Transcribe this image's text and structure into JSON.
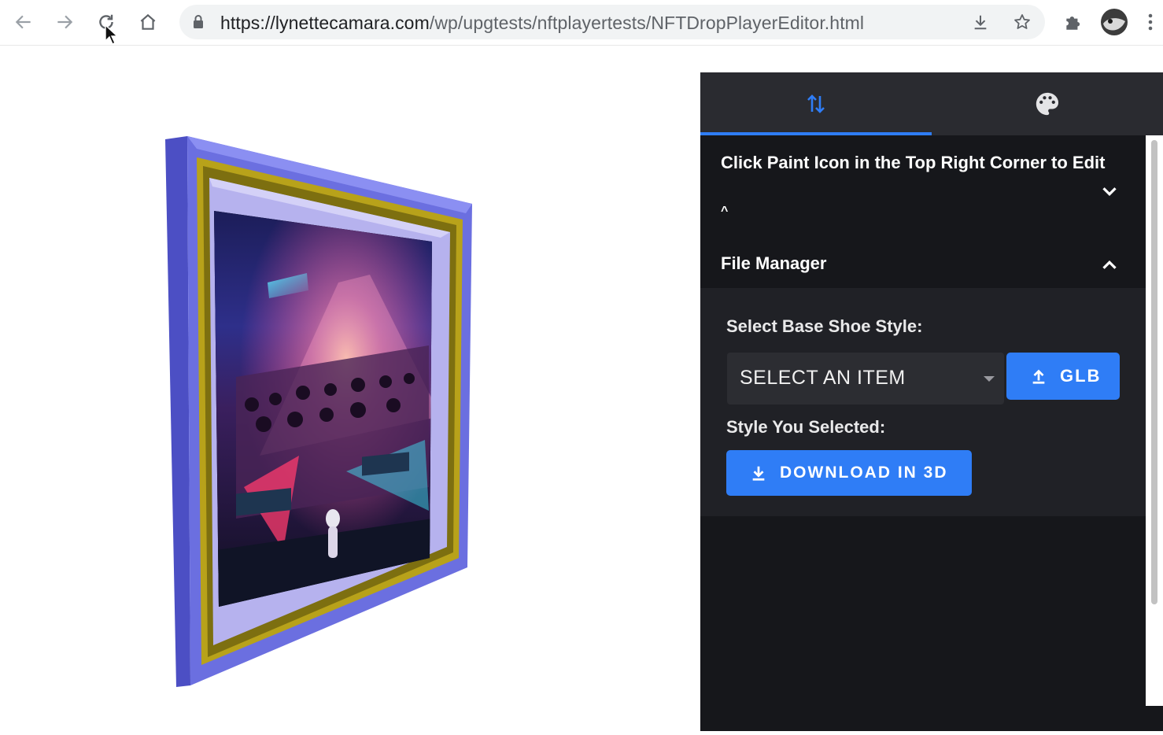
{
  "browser": {
    "url_host": "https://lynettecamara.com",
    "url_path": "/wp/upgtests/nftplayertests/NFTDropPlayerEditor.html"
  },
  "panel": {
    "tabs": [
      {
        "icon": "sort-arrows-icon",
        "active": true
      },
      {
        "icon": "palette-icon",
        "active": false
      }
    ],
    "instructions": {
      "title": "Click Paint Icon in the Top Right Corner to Edit",
      "caret_text": "^"
    },
    "file_manager": {
      "title": "File Manager",
      "base_style_label": "Select Base Shoe Style:",
      "select_value": "SELECT AN ITEM",
      "glb_button": "GLB",
      "selected_label": "Style You Selected:",
      "download_button": "DOWNLOAD IN 3D"
    }
  },
  "colors": {
    "accent": "#2f7df6",
    "panel_bg": "#16171b",
    "frame_outer": "#6b6fe0",
    "frame_gold": "#b8a21a",
    "mat": "#b6b2ee"
  }
}
